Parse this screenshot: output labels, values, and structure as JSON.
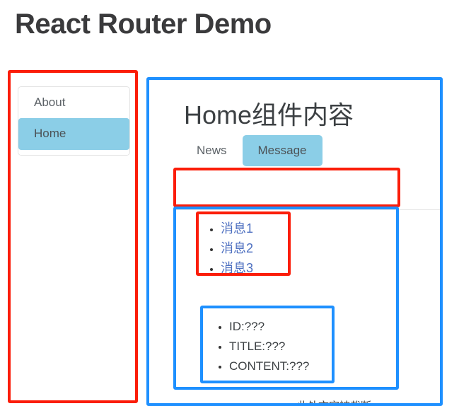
{
  "page": {
    "title": "React Router Demo"
  },
  "sidebar": {
    "items": [
      {
        "label": "About",
        "active": false
      },
      {
        "label": "Home",
        "active": true
      }
    ]
  },
  "main": {
    "heading": "Home组件内容",
    "tabs": [
      {
        "label": "News",
        "active": false
      },
      {
        "label": "Message",
        "active": true
      }
    ],
    "message_links": [
      {
        "label": "消息1"
      },
      {
        "label": "消息2"
      },
      {
        "label": "消息3"
      }
    ],
    "detail_items": [
      {
        "label": "ID:???"
      },
      {
        "label": "TITLE:???"
      },
      {
        "label": "CONTENT:???"
      }
    ],
    "cutoff_text": "……此处文字被截断……"
  },
  "colors": {
    "active_tab_bg": "#8bcee7",
    "active_nav_bg": "#8bcee7",
    "link_blue": "#4d6fc0",
    "annotation_red": "#fb1d09",
    "annotation_blue": "#1e90ff",
    "text_dark": "#3c4043",
    "card_border": "#e3e3e3",
    "divider": "#e6e6e6"
  }
}
